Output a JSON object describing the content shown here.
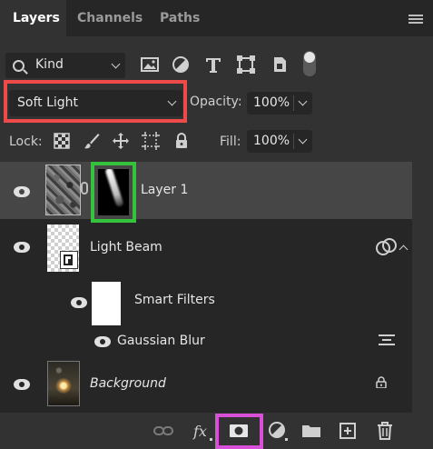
{
  "tabs": [
    {
      "label": "Layers",
      "active": true
    },
    {
      "label": "Channels",
      "active": false
    },
    {
      "label": "Paths",
      "active": false
    }
  ],
  "filter": {
    "kind_label": "Kind",
    "filter_icons": [
      "image-filter-icon",
      "adjustment-filter-icon",
      "type-filter-icon",
      "shape-filter-icon",
      "smart-object-filter-icon"
    ]
  },
  "blend": {
    "mode": "Soft Light",
    "opacity_label": "Opacity:",
    "opacity_value": "100%"
  },
  "lock": {
    "label": "Lock:",
    "icons": [
      "lock-transparent-icon",
      "lock-paint-icon",
      "lock-position-icon",
      "lock-artboard-icon",
      "lock-all-icon"
    ],
    "fill_label": "Fill:",
    "fill_value": "100%"
  },
  "layers": {
    "layer1": {
      "name": "Layer 1",
      "selected": true,
      "visible": true
    },
    "light_beam": {
      "name": "Light Beam",
      "visible": true
    },
    "smart_filters": {
      "name": "Smart Filters",
      "visible": true
    },
    "gaussian_blur": {
      "name": "Gaussian Blur",
      "visible": true
    },
    "background": {
      "name": "Background",
      "visible": true,
      "locked": true
    }
  },
  "bottom_icons": [
    "link-icon",
    "fx-icon",
    "add-mask-icon",
    "adjustment-layer-icon",
    "folder-icon",
    "new-layer-icon",
    "trash-icon"
  ],
  "highlights": {
    "blend_mode": "#ee4a4a",
    "layer_mask": "#35c23c",
    "add_mask_button": "#d750d7"
  },
  "colors": {
    "panel": "#323232",
    "tabbar": "#262626",
    "list_bg": "#262626",
    "selected_row": "#464646"
  }
}
